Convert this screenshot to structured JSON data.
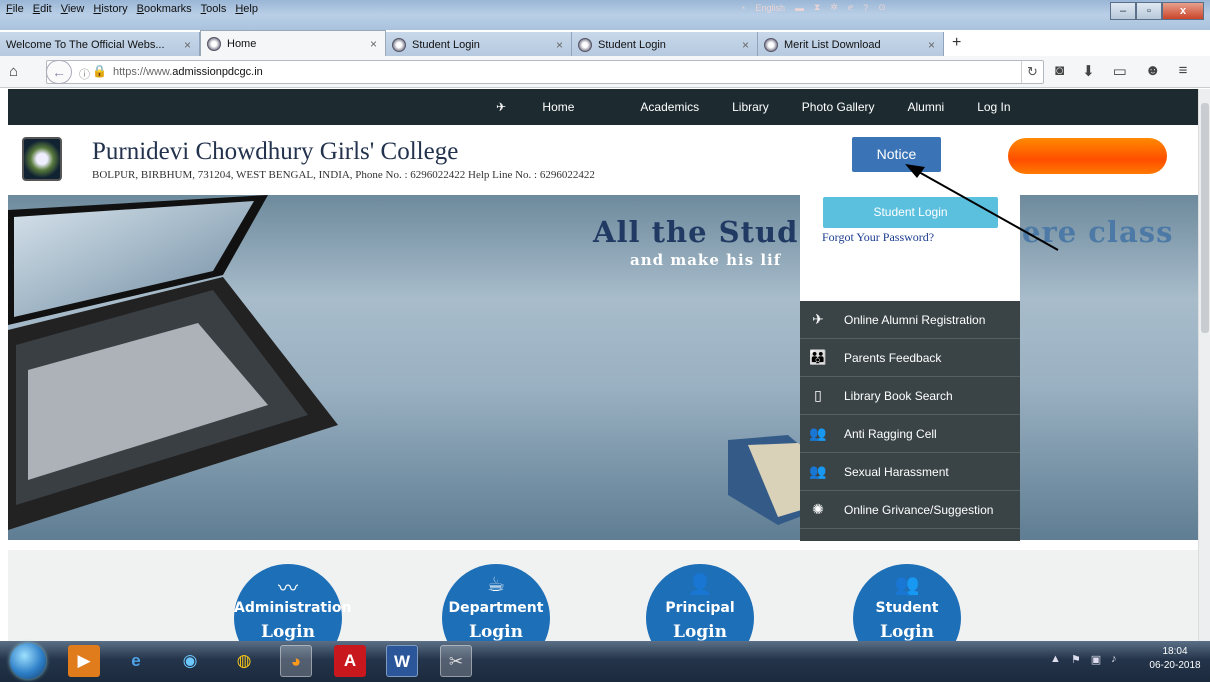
{
  "browser": {
    "menus": [
      "File",
      "Edit",
      "View",
      "History",
      "Bookmarks",
      "Tools",
      "Help"
    ],
    "extension_label": "English",
    "tabs": [
      {
        "label": "Welcome To The Official Webs...",
        "active": false
      },
      {
        "label": "Home",
        "active": true
      },
      {
        "label": "Student Login",
        "active": false
      },
      {
        "label": "Student Login",
        "active": false
      },
      {
        "label": "Merit List Download",
        "active": false
      }
    ],
    "url_prefix": "https://www.",
    "url_domain": "admissionpdcgc.in"
  },
  "site": {
    "topnav": [
      "Home",
      "Academics",
      "Library",
      "Photo Gallery",
      "Alumni",
      "Log In"
    ],
    "college_name": "Purnidevi Chowdhury Girls' College",
    "address": "BOLPUR, BIRBHUM, 731204, WEST BENGAL, INDIA, Phone No. : 6296022422   Help Line No. : 6296022422",
    "notice_label": "Notice",
    "banner": {
      "line1_left": "All the Stud",
      "line1_right": "ere class",
      "line2": "and make his lif"
    },
    "dropdown": {
      "student_login": "Student Login",
      "forgot": "Forgot Your Password?"
    },
    "side_menu": [
      {
        "label": "Online Alumni Registration",
        "icon": "satellite-icon"
      },
      {
        "label": "Parents Feedback",
        "icon": "family-icon"
      },
      {
        "label": "Library Book Search",
        "icon": "book-search-icon"
      },
      {
        "label": "Anti Ragging Cell",
        "icon": "group-icon"
      },
      {
        "label": "Sexual Harassment",
        "icon": "group-icon"
      },
      {
        "label": "Online Grivance/Suggestion",
        "icon": "bulb-icon"
      }
    ],
    "logins": [
      {
        "line1": "Administration",
        "line2": "Login"
      },
      {
        "line1": "Department",
        "line2": "Login"
      },
      {
        "line1": "Principal",
        "line2": "Login"
      },
      {
        "line1": "Student",
        "line2": "Login"
      }
    ]
  },
  "taskbar": {
    "time": "18:04",
    "date": "06-20-2018"
  }
}
